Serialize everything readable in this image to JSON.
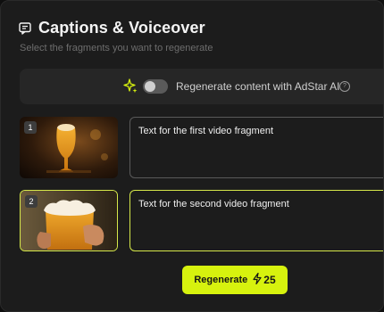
{
  "header": {
    "title": "Captions & Voiceover",
    "icon": "chat-icon"
  },
  "subtitle": "Select the fragments you want to regenerate",
  "ai": {
    "label": "Regenerate content with AdStar AI",
    "enabled": false,
    "help_icon": "help-icon",
    "sparkle_icon": "sparkle-icon"
  },
  "fragments": [
    {
      "number": "1",
      "text": "Text for the first video fragment",
      "selected": false
    },
    {
      "number": "2",
      "text": "Text for the second video fragment",
      "selected": true
    }
  ],
  "regenerate": {
    "label": "Regenerate",
    "count": "25",
    "icon": "lightning-icon"
  },
  "colors": {
    "accent": "#d7f20e",
    "background": "#1c1c1c",
    "selected_border": "#d6e84a"
  }
}
